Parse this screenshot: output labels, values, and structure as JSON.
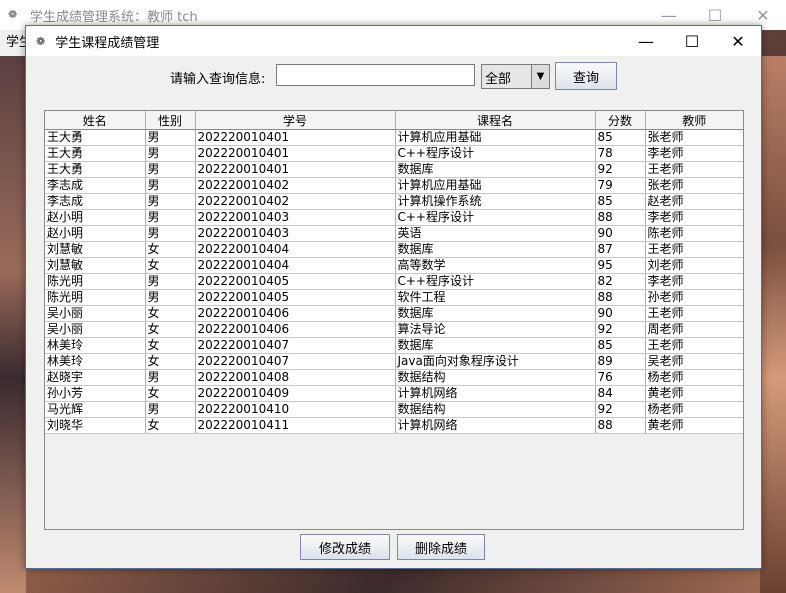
{
  "main_window": {
    "title": "学生成绩管理系统：教师 tch",
    "menu_fragment": "学生",
    "controls": {
      "minimize": "—",
      "maximize": "☐",
      "close": "✕"
    }
  },
  "dialog": {
    "title": "学生课程成绩管理",
    "controls": {
      "minimize": "—",
      "maximize": "☐",
      "close": "✕"
    }
  },
  "search": {
    "label": "请输入查询信息:",
    "value": "",
    "filter_selected": "全部",
    "dropdown_arrow": "▼",
    "query_button": "查询"
  },
  "table": {
    "columns": [
      "姓名",
      "性别",
      "学号",
      "课程名",
      "分数",
      "教师"
    ],
    "rows": [
      [
        "王大勇",
        "男",
        "202220010401",
        "计算机应用基础",
        "85",
        "张老师"
      ],
      [
        "王大勇",
        "男",
        "202220010401",
        "C++程序设计",
        "78",
        "李老师"
      ],
      [
        "王大勇",
        "男",
        "202220010401",
        "数据库",
        "92",
        "王老师"
      ],
      [
        "李志成",
        "男",
        "202220010402",
        "计算机应用基础",
        "79",
        "张老师"
      ],
      [
        "李志成",
        "男",
        "202220010402",
        "计算机操作系统",
        "85",
        "赵老师"
      ],
      [
        "赵小明",
        "男",
        "202220010403",
        "C++程序设计",
        "88",
        "李老师"
      ],
      [
        "赵小明",
        "男",
        "202220010403",
        "英语",
        "90",
        "陈老师"
      ],
      [
        "刘慧敏",
        "女",
        "202220010404",
        "数据库",
        "87",
        "王老师"
      ],
      [
        "刘慧敏",
        "女",
        "202220010404",
        "高等数学",
        "95",
        "刘老师"
      ],
      [
        "陈光明",
        "男",
        "202220010405",
        "C++程序设计",
        "82",
        "李老师"
      ],
      [
        "陈光明",
        "男",
        "202220010405",
        "软件工程",
        "88",
        "孙老师"
      ],
      [
        "吴小丽",
        "女",
        "202220010406",
        "数据库",
        "90",
        "王老师"
      ],
      [
        "吴小丽",
        "女",
        "202220010406",
        "算法导论",
        "92",
        "周老师"
      ],
      [
        "林美玲",
        "女",
        "202220010407",
        "数据库",
        "85",
        "王老师"
      ],
      [
        "林美玲",
        "女",
        "202220010407",
        "Java面向对象程序设计",
        "89",
        "吴老师"
      ],
      [
        "赵晓宇",
        "男",
        "202220010408",
        "数据结构",
        "76",
        "杨老师"
      ],
      [
        "孙小芳",
        "女",
        "202220010409",
        "计算机网络",
        "84",
        "黄老师"
      ],
      [
        "马光辉",
        "男",
        "202220010410",
        "数据结构",
        "92",
        "杨老师"
      ],
      [
        "刘晓华",
        "女",
        "202220010411",
        "计算机网络",
        "88",
        "黄老师"
      ]
    ]
  },
  "actions": {
    "modify_button": "修改成绩",
    "delete_button": "删除成绩"
  },
  "icons": {
    "app_icon": "gear-icon"
  }
}
